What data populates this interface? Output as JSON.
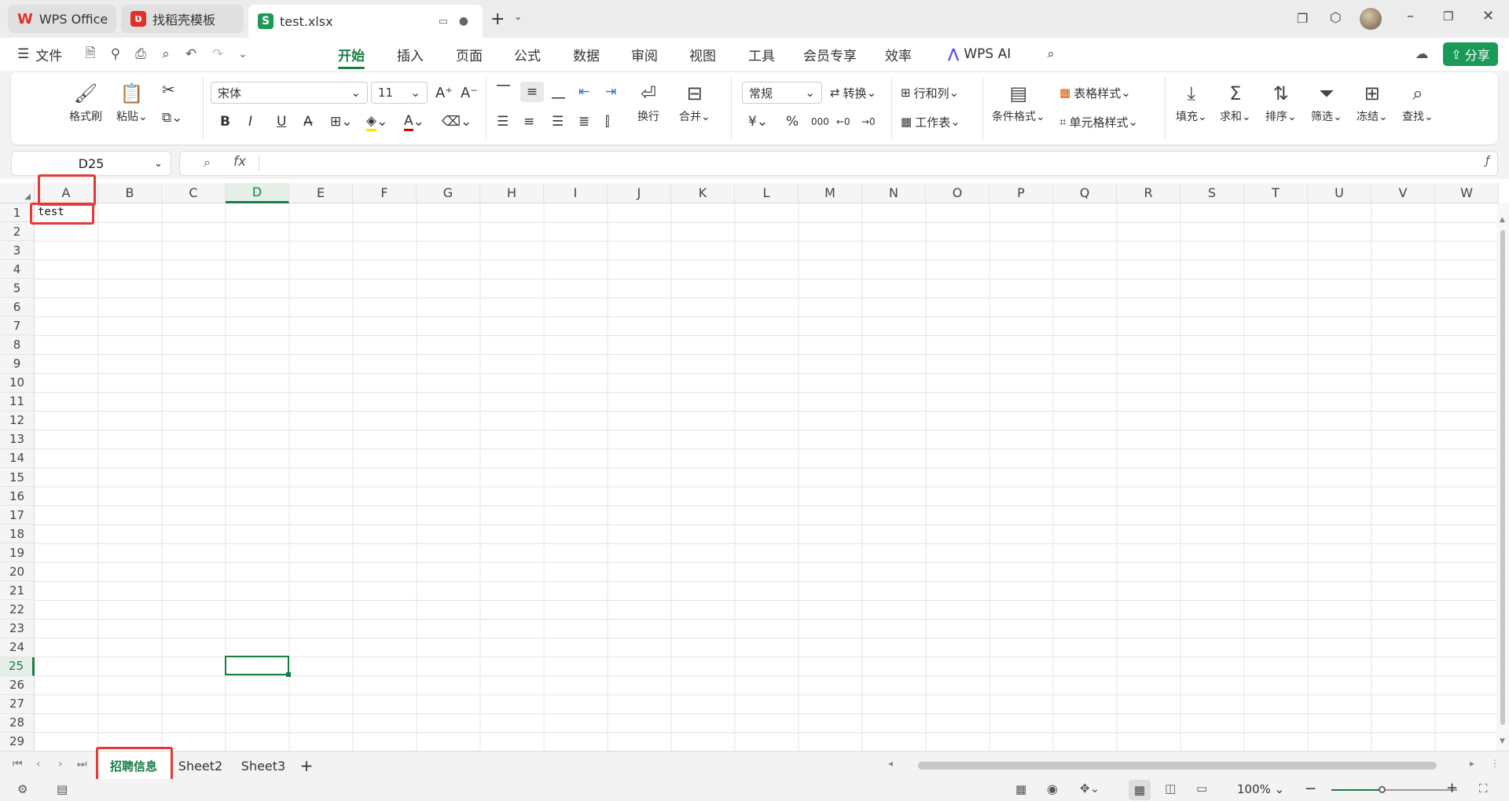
{
  "tabs": [
    {
      "label": "WPS Office"
    },
    {
      "label": "找稻壳模板"
    },
    {
      "label": "test.xlsx"
    }
  ],
  "menu": {
    "file": "文件",
    "items": [
      "开始",
      "插入",
      "页面",
      "公式",
      "数据",
      "审阅",
      "视图",
      "工具",
      "会员专享",
      "效率"
    ],
    "wps_ai": "WPS AI",
    "share": "分享"
  },
  "ribbon": {
    "format_painter": "格式刷",
    "paste": "粘贴",
    "font_name": "宋体",
    "font_size": "11",
    "wrap": "换行",
    "merge": "合并",
    "number_format": "常规",
    "convert": "转换",
    "rows_cols": "行和列",
    "worksheet": "工作表",
    "cond_format": "条件格式",
    "table_style": "表格样式",
    "cell_style": "单元格样式",
    "fill": "填充",
    "sum": "求和",
    "sort": "排序",
    "filter": "筛选",
    "freeze": "冻结",
    "find": "查找"
  },
  "formula_bar": {
    "name_box": "D25",
    "fx": "fx"
  },
  "columns": [
    "A",
    "B",
    "C",
    "D",
    "E",
    "F",
    "G",
    "H",
    "I",
    "J",
    "K",
    "L",
    "M",
    "N",
    "O",
    "P",
    "Q",
    "R",
    "S",
    "T",
    "U",
    "V",
    "W"
  ],
  "rows": [
    "1",
    "2",
    "3",
    "4",
    "5",
    "6",
    "7",
    "8",
    "9",
    "10",
    "11",
    "12",
    "13",
    "14",
    "15",
    "16",
    "17",
    "18",
    "19",
    "20",
    "21",
    "22",
    "23",
    "24",
    "25",
    "26",
    "27",
    "28",
    "29"
  ],
  "cells": {
    "A1": "test"
  },
  "sheets": [
    "招聘信息",
    "Sheet2",
    "Sheet3"
  ],
  "status": {
    "zoom": "100%"
  },
  "colors": {
    "accent": "#1a7d46",
    "highlight": "#e53935"
  }
}
